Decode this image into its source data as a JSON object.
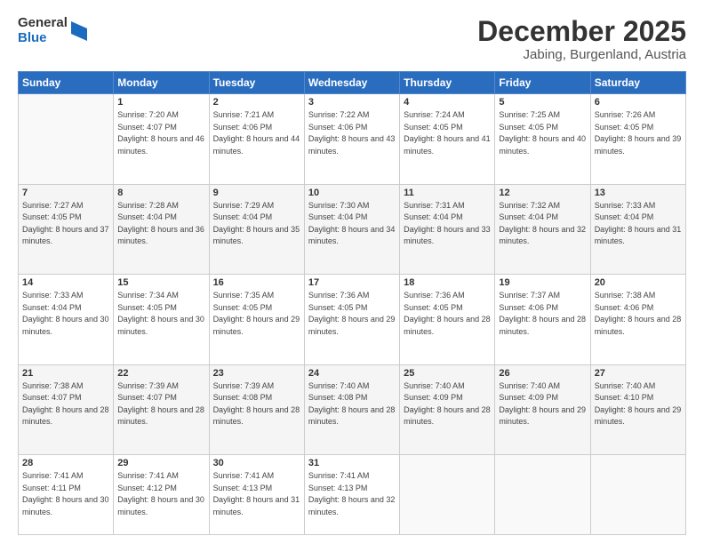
{
  "logo": {
    "general": "General",
    "blue": "Blue"
  },
  "header": {
    "month": "December 2025",
    "location": "Jabing, Burgenland, Austria"
  },
  "weekdays": [
    "Sunday",
    "Monday",
    "Tuesday",
    "Wednesday",
    "Thursday",
    "Friday",
    "Saturday"
  ],
  "weeks": [
    [
      {
        "day": "",
        "sunrise": "",
        "sunset": "",
        "daylight": ""
      },
      {
        "day": "1",
        "sunrise": "Sunrise: 7:20 AM",
        "sunset": "Sunset: 4:07 PM",
        "daylight": "Daylight: 8 hours and 46 minutes."
      },
      {
        "day": "2",
        "sunrise": "Sunrise: 7:21 AM",
        "sunset": "Sunset: 4:06 PM",
        "daylight": "Daylight: 8 hours and 44 minutes."
      },
      {
        "day": "3",
        "sunrise": "Sunrise: 7:22 AM",
        "sunset": "Sunset: 4:06 PM",
        "daylight": "Daylight: 8 hours and 43 minutes."
      },
      {
        "day": "4",
        "sunrise": "Sunrise: 7:24 AM",
        "sunset": "Sunset: 4:05 PM",
        "daylight": "Daylight: 8 hours and 41 minutes."
      },
      {
        "day": "5",
        "sunrise": "Sunrise: 7:25 AM",
        "sunset": "Sunset: 4:05 PM",
        "daylight": "Daylight: 8 hours and 40 minutes."
      },
      {
        "day": "6",
        "sunrise": "Sunrise: 7:26 AM",
        "sunset": "Sunset: 4:05 PM",
        "daylight": "Daylight: 8 hours and 39 minutes."
      }
    ],
    [
      {
        "day": "7",
        "sunrise": "Sunrise: 7:27 AM",
        "sunset": "Sunset: 4:05 PM",
        "daylight": "Daylight: 8 hours and 37 minutes."
      },
      {
        "day": "8",
        "sunrise": "Sunrise: 7:28 AM",
        "sunset": "Sunset: 4:04 PM",
        "daylight": "Daylight: 8 hours and 36 minutes."
      },
      {
        "day": "9",
        "sunrise": "Sunrise: 7:29 AM",
        "sunset": "Sunset: 4:04 PM",
        "daylight": "Daylight: 8 hours and 35 minutes."
      },
      {
        "day": "10",
        "sunrise": "Sunrise: 7:30 AM",
        "sunset": "Sunset: 4:04 PM",
        "daylight": "Daylight: 8 hours and 34 minutes."
      },
      {
        "day": "11",
        "sunrise": "Sunrise: 7:31 AM",
        "sunset": "Sunset: 4:04 PM",
        "daylight": "Daylight: 8 hours and 33 minutes."
      },
      {
        "day": "12",
        "sunrise": "Sunrise: 7:32 AM",
        "sunset": "Sunset: 4:04 PM",
        "daylight": "Daylight: 8 hours and 32 minutes."
      },
      {
        "day": "13",
        "sunrise": "Sunrise: 7:33 AM",
        "sunset": "Sunset: 4:04 PM",
        "daylight": "Daylight: 8 hours and 31 minutes."
      }
    ],
    [
      {
        "day": "14",
        "sunrise": "Sunrise: 7:33 AM",
        "sunset": "Sunset: 4:04 PM",
        "daylight": "Daylight: 8 hours and 30 minutes."
      },
      {
        "day": "15",
        "sunrise": "Sunrise: 7:34 AM",
        "sunset": "Sunset: 4:05 PM",
        "daylight": "Daylight: 8 hours and 30 minutes."
      },
      {
        "day": "16",
        "sunrise": "Sunrise: 7:35 AM",
        "sunset": "Sunset: 4:05 PM",
        "daylight": "Daylight: 8 hours and 29 minutes."
      },
      {
        "day": "17",
        "sunrise": "Sunrise: 7:36 AM",
        "sunset": "Sunset: 4:05 PM",
        "daylight": "Daylight: 8 hours and 29 minutes."
      },
      {
        "day": "18",
        "sunrise": "Sunrise: 7:36 AM",
        "sunset": "Sunset: 4:05 PM",
        "daylight": "Daylight: 8 hours and 28 minutes."
      },
      {
        "day": "19",
        "sunrise": "Sunrise: 7:37 AM",
        "sunset": "Sunset: 4:06 PM",
        "daylight": "Daylight: 8 hours and 28 minutes."
      },
      {
        "day": "20",
        "sunrise": "Sunrise: 7:38 AM",
        "sunset": "Sunset: 4:06 PM",
        "daylight": "Daylight: 8 hours and 28 minutes."
      }
    ],
    [
      {
        "day": "21",
        "sunrise": "Sunrise: 7:38 AM",
        "sunset": "Sunset: 4:07 PM",
        "daylight": "Daylight: 8 hours and 28 minutes."
      },
      {
        "day": "22",
        "sunrise": "Sunrise: 7:39 AM",
        "sunset": "Sunset: 4:07 PM",
        "daylight": "Daylight: 8 hours and 28 minutes."
      },
      {
        "day": "23",
        "sunrise": "Sunrise: 7:39 AM",
        "sunset": "Sunset: 4:08 PM",
        "daylight": "Daylight: 8 hours and 28 minutes."
      },
      {
        "day": "24",
        "sunrise": "Sunrise: 7:40 AM",
        "sunset": "Sunset: 4:08 PM",
        "daylight": "Daylight: 8 hours and 28 minutes."
      },
      {
        "day": "25",
        "sunrise": "Sunrise: 7:40 AM",
        "sunset": "Sunset: 4:09 PM",
        "daylight": "Daylight: 8 hours and 28 minutes."
      },
      {
        "day": "26",
        "sunrise": "Sunrise: 7:40 AM",
        "sunset": "Sunset: 4:09 PM",
        "daylight": "Daylight: 8 hours and 29 minutes."
      },
      {
        "day": "27",
        "sunrise": "Sunrise: 7:40 AM",
        "sunset": "Sunset: 4:10 PM",
        "daylight": "Daylight: 8 hours and 29 minutes."
      }
    ],
    [
      {
        "day": "28",
        "sunrise": "Sunrise: 7:41 AM",
        "sunset": "Sunset: 4:11 PM",
        "daylight": "Daylight: 8 hours and 30 minutes."
      },
      {
        "day": "29",
        "sunrise": "Sunrise: 7:41 AM",
        "sunset": "Sunset: 4:12 PM",
        "daylight": "Daylight: 8 hours and 30 minutes."
      },
      {
        "day": "30",
        "sunrise": "Sunrise: 7:41 AM",
        "sunset": "Sunset: 4:13 PM",
        "daylight": "Daylight: 8 hours and 31 minutes."
      },
      {
        "day": "31",
        "sunrise": "Sunrise: 7:41 AM",
        "sunset": "Sunset: 4:13 PM",
        "daylight": "Daylight: 8 hours and 32 minutes."
      },
      {
        "day": "",
        "sunrise": "",
        "sunset": "",
        "daylight": ""
      },
      {
        "day": "",
        "sunrise": "",
        "sunset": "",
        "daylight": ""
      },
      {
        "day": "",
        "sunrise": "",
        "sunset": "",
        "daylight": ""
      }
    ]
  ]
}
